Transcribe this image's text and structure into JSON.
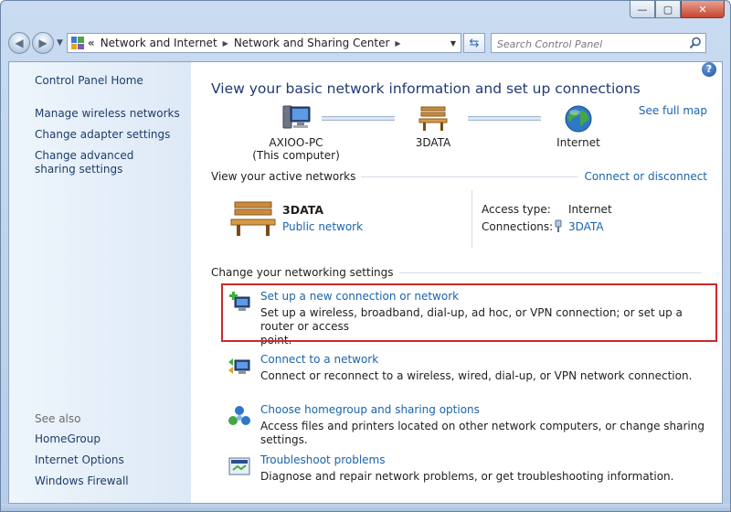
{
  "window": {
    "caption": {
      "minimize": "—",
      "maximize": "▢",
      "close": "✕"
    }
  },
  "address_bar": {
    "history_glyph": "«",
    "breadcrumbs": [
      "Network and Internet",
      "Network and Sharing Center"
    ],
    "separator": "▶",
    "dropdown": "▼"
  },
  "search": {
    "placeholder": "Search Control Panel"
  },
  "sidebar": {
    "home": "Control Panel Home",
    "links": [
      "Manage wireless networks",
      "Change adapter settings",
      "Change advanced sharing settings"
    ],
    "see_also_heading": "See also",
    "see_also": [
      "HomeGroup",
      "Internet Options",
      "Windows Firewall"
    ]
  },
  "main": {
    "help": "?",
    "title": "View your basic network information and set up connections",
    "see_full_map": "See full map",
    "map_nodes": [
      {
        "line1": "AXIOO-PC",
        "line2": "(This computer)",
        "icon": "computer-icon"
      },
      {
        "line1": "3DATA",
        "line2": "",
        "icon": "bench-icon"
      },
      {
        "line1": "Internet",
        "line2": "",
        "icon": "globe-icon"
      }
    ],
    "active_networks": {
      "heading": "View your active networks",
      "action": "Connect or disconnect",
      "network_name": "3DATA",
      "network_type": "Public network",
      "access_type_label": "Access type:",
      "access_type_value": "Internet",
      "connections_label": "Connections:",
      "connections_value": "3DATA"
    },
    "settings": {
      "heading": "Change your networking settings",
      "tasks": [
        {
          "title": "Set up a new connection or network",
          "desc1": "Set up a wireless, broadband, dial-up, ad hoc, or VPN connection; or set up a router or access",
          "desc2": "point."
        },
        {
          "title": "Connect to a network",
          "desc1": "Connect or reconnect to a wireless, wired, dial-up, or VPN network connection.",
          "desc2": ""
        },
        {
          "title": "Choose homegroup and sharing options",
          "desc1": "Access files and printers located on other network computers, or change sharing settings.",
          "desc2": ""
        },
        {
          "title": "Troubleshoot problems",
          "desc1": "Diagnose and repair network problems, or get troubleshooting information.",
          "desc2": ""
        }
      ]
    }
  },
  "colors": {
    "link": "#1a64ad",
    "title": "#1e3a73",
    "highlight": "#d0262c"
  }
}
